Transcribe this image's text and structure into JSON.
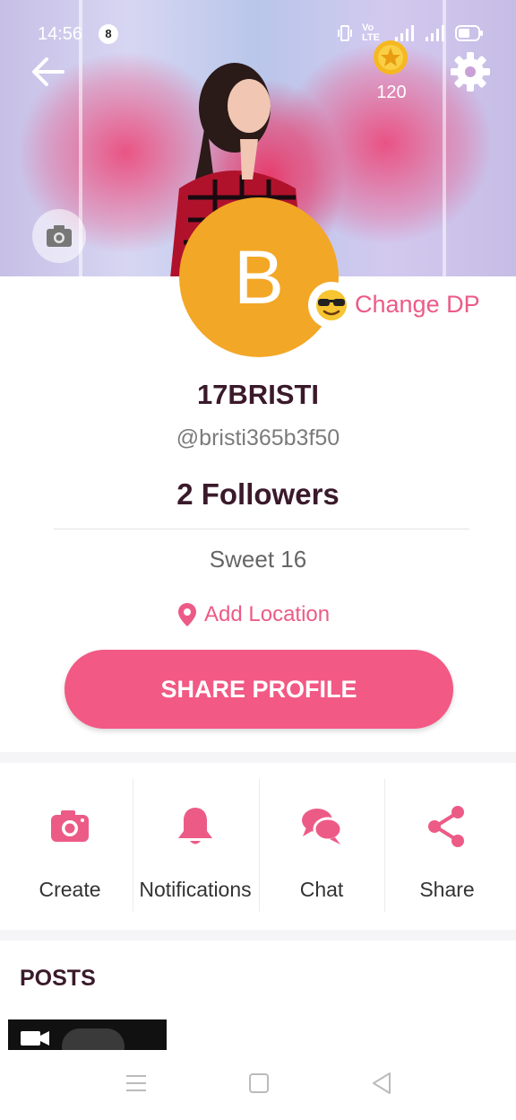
{
  "status_bar": {
    "time": "14:56",
    "notification_count": "8",
    "network_label": "Vo LTE"
  },
  "header": {
    "coin_count": "120"
  },
  "profile": {
    "avatar_letter": "B",
    "change_dp_label": "Change DP",
    "username": "17BRISTI",
    "handle": "@bristi365b3f50",
    "followers": "2 Followers",
    "bio": "Sweet 16",
    "add_location_label": "Add Location",
    "share_button_label": "SHARE PROFILE"
  },
  "actions": [
    {
      "label": "Create",
      "icon": "camera-icon"
    },
    {
      "label": "Notifications",
      "icon": "bell-icon"
    },
    {
      "label": "Chat",
      "icon": "chat-bubbles-icon"
    },
    {
      "label": "Share",
      "icon": "share-icon"
    }
  ],
  "posts": {
    "title": "POSTS"
  },
  "colors": {
    "accent": "#f25984",
    "avatar_bg": "#f3a726",
    "heading": "#3a1a2a"
  }
}
